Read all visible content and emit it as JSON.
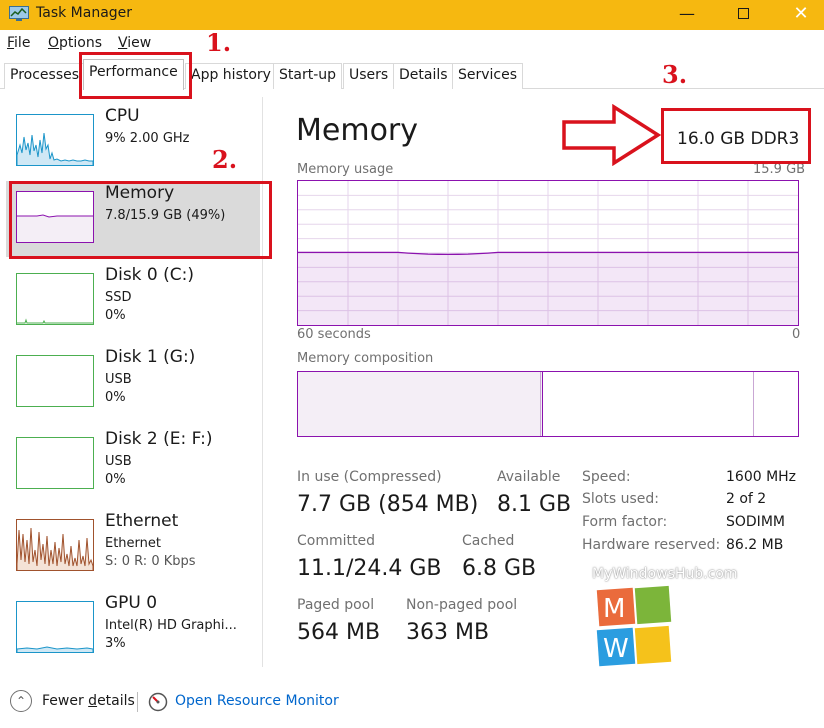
{
  "window": {
    "title": "Task Manager",
    "controls": {
      "minimize": "—",
      "close": "✕"
    }
  },
  "menu": [
    {
      "hotkey": "F",
      "rest": "ile"
    },
    {
      "hotkey": "O",
      "rest": "ptions"
    },
    {
      "hotkey": "V",
      "rest": "iew"
    }
  ],
  "tabs": [
    "Processes",
    "Performance",
    "App history",
    "Start-up",
    "Users",
    "Details",
    "Services"
  ],
  "active_tab": "Performance",
  "resources": [
    {
      "name": "CPU",
      "lines": [
        "9%  2.00 GHz"
      ]
    },
    {
      "name": "Memory",
      "lines": [
        "7.8/15.9 GB (49%)"
      ]
    },
    {
      "name": "Disk 0 (C:)",
      "lines": [
        "SSD",
        "0%"
      ]
    },
    {
      "name": "Disk 1 (G:)",
      "lines": [
        "USB",
        "0%"
      ]
    },
    {
      "name": "Disk 2 (E: F:)",
      "lines": [
        "USB",
        "0%"
      ]
    },
    {
      "name": "Ethernet",
      "lines": [
        "Ethernet",
        "S: 0  R: 0 Kbps"
      ]
    },
    {
      "name": "GPU 0",
      "lines": [
        "Intel(R) HD Graphi...",
        "3%"
      ]
    }
  ],
  "selected_resource": "Memory",
  "detail": {
    "heading": "Memory",
    "spec": "16.0 GB DDR3",
    "usage_label": "Memory usage",
    "usage_max": "15.9 GB",
    "time_left": "60 seconds",
    "time_right": "0",
    "composition_label": "Memory composition",
    "usage_fraction": 0.49,
    "stats": {
      "in_use_label": "In use (Compressed)",
      "in_use_value": "7.7 GB (854 MB)",
      "available_label": "Available",
      "available_value": "8.1 GB",
      "committed_label": "Committed",
      "committed_value": "11.1/24.4 GB",
      "cached_label": "Cached",
      "cached_value": "6.8 GB",
      "paged_label": "Paged pool",
      "paged_value": "564 MB",
      "nonpaged_label": "Non-paged pool",
      "nonpaged_value": "363 MB"
    },
    "hardware": [
      {
        "label": "Speed:",
        "value": "1600 MHz"
      },
      {
        "label": "Slots used:",
        "value": "2 of 2"
      },
      {
        "label": "Form factor:",
        "value": "SODIMM"
      },
      {
        "label": "Hardware reserved:",
        "value": "86.2 MB"
      }
    ]
  },
  "footer": {
    "fewer_hotkey_prefix": "Fewer ",
    "fewer_hotkey": "d",
    "fewer_rest": "etails",
    "resource_monitor": "Open Resource Monitor"
  },
  "annotations": [
    "1.",
    "2.",
    "3."
  ],
  "watermark": {
    "text": "MyWindowsHub.com",
    "letters": [
      "M",
      "W"
    ]
  },
  "colors": {
    "titlebar": "#f6b810",
    "memory_accent": "#8b12ae",
    "cpu_accent": "#1b95c9",
    "disk_accent": "#4caf50",
    "ethernet_accent": "#a0522d",
    "annotation_red": "#d9121d",
    "link": "#0066cc"
  },
  "icons": {
    "app": "task-manager-icon",
    "fewer": "chevron-up-circle-icon",
    "resource_monitor": "resource-monitor-icon"
  }
}
